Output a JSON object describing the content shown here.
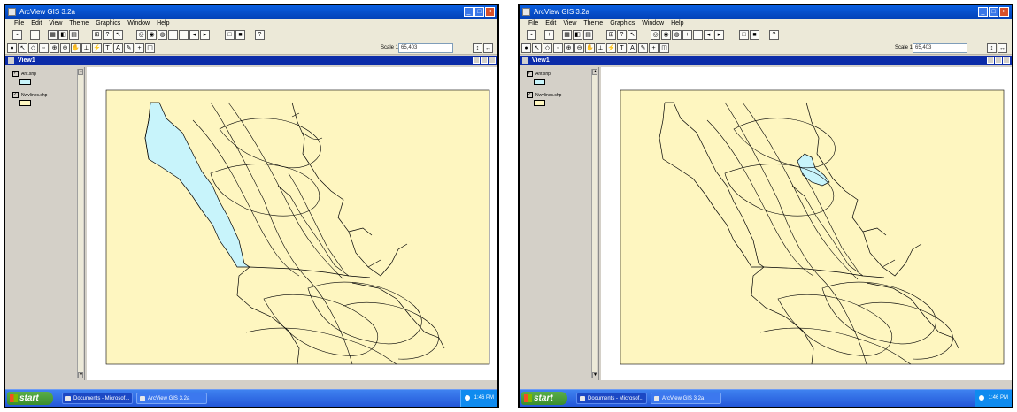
{
  "screens": [
    {
      "id": "left",
      "title": "ArcView GIS 3.2a",
      "menu": [
        "File",
        "Edit",
        "View",
        "Theme",
        "Graphics",
        "Window",
        "Help"
      ],
      "scale_label": "Scale 1:",
      "scale_value": "65,403",
      "view_title": "View1",
      "themes": [
        {
          "label": "Ant.shp",
          "swatch": "#c8f4fb",
          "checked": true
        },
        {
          "label": "Nwvlines.shp",
          "swatch": "#fef6c0",
          "checked": true
        }
      ],
      "highlighted_polygon": "west-coast-strip",
      "taskbar": {
        "start": "start",
        "items": [
          "Documents - Microsof...",
          "ArcView GIS 3.2a"
        ],
        "clock": "1:46 PM"
      }
    },
    {
      "id": "right",
      "title": "ArcView GIS 3.2a",
      "menu": [
        "File",
        "Edit",
        "View",
        "Theme",
        "Graphics",
        "Window",
        "Help"
      ],
      "scale_label": "Scale 1:",
      "scale_value": "65,403",
      "view_title": "View1",
      "themes": [
        {
          "label": "Ant.shp",
          "swatch": "#c8f4fb",
          "checked": true
        },
        {
          "label": "Nwvlines.shp",
          "swatch": "#fef6c0",
          "checked": true
        }
      ],
      "highlighted_polygon": "small-lake",
      "taskbar": {
        "start": "start",
        "items": [
          "Documents - Microsof...",
          "ArcView GIS 3.2a"
        ],
        "clock": "1:46 PM"
      }
    }
  ],
  "colors": {
    "map_fill": "#fef6c0",
    "highlight": "#c8f4fb",
    "title_blue": "#0a5fe0",
    "view_title_blue": "#0b2ba8",
    "taskbar_blue": "#2356d8",
    "start_green": "#3a8e2c"
  }
}
